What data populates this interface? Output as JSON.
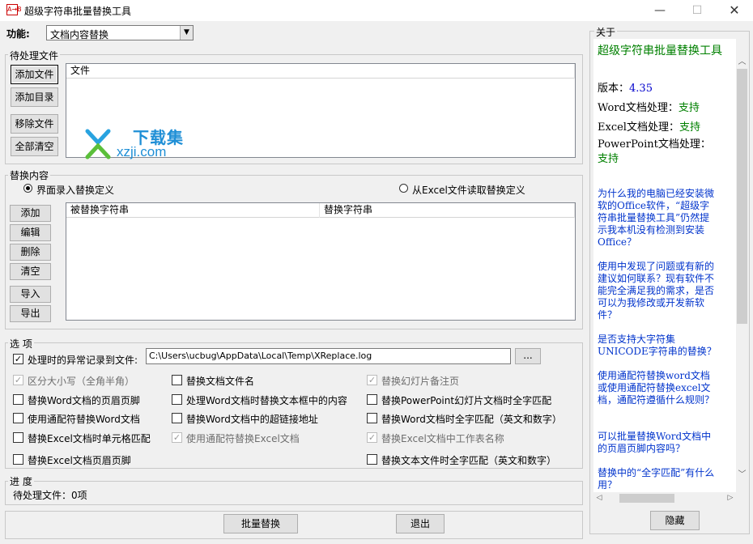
{
  "window": {
    "title": "超级字符串批量替换工具",
    "minimize": "—",
    "maximize": "☐",
    "close": "✕",
    "icon": "app-icon"
  },
  "function": {
    "label": "功能:",
    "selected": "文档内容替换"
  },
  "files": {
    "title": "待处理文件",
    "buttons": {
      "add_file": "添加文件",
      "add_dir": "添加目录",
      "remove_file": "移除文件",
      "clear_all": "全部清空"
    },
    "column": "文件"
  },
  "watermark": {
    "line1": "下载集",
    "line2": "xzji.com"
  },
  "replace": {
    "title": "替换内容",
    "radio_ui": "界面录入替换定义",
    "radio_excel": "从Excel文件读取替换定义",
    "buttons": {
      "add": "添加",
      "edit": "编辑",
      "delete": "删除",
      "clear": "清空",
      "import": "导入",
      "export": "导出"
    },
    "col_from": "被替换字符串",
    "col_to": "替换字符串"
  },
  "options": {
    "title": "选 项",
    "log_label": "处理时的异常记录到文件:",
    "log_path": "C:\\Users\\ucbug\\AppData\\Local\\Temp\\XReplace.log",
    "browse": "...",
    "items": [
      {
        "label": "区分大小写（全角半角）",
        "checked": true,
        "disabled": true
      },
      {
        "label": "替换文档文件名",
        "checked": false,
        "disabled": false
      },
      {
        "label": "替换幻灯片备注页",
        "checked": true,
        "disabled": true
      },
      {
        "label": "替换Word文档的页眉页脚",
        "checked": false,
        "disabled": false
      },
      {
        "label": "处理Word文档时替换文本框中的内容",
        "checked": false,
        "disabled": false
      },
      {
        "label": "替换PowerPoint幻灯片文档时全字匹配",
        "checked": false,
        "disabled": false
      },
      {
        "label": "使用通配符替换Word文档",
        "checked": false,
        "disabled": false
      },
      {
        "label": "替换Word文档中的超链接地址",
        "checked": false,
        "disabled": false
      },
      {
        "label": "替换Word文档时全字匹配（英文和数字）",
        "checked": false,
        "disabled": false
      },
      {
        "label": "替换Excel文档时单元格匹配",
        "checked": false,
        "disabled": false
      },
      {
        "label": "使用通配符替换Excel文档",
        "checked": true,
        "disabled": true
      },
      {
        "label": "替换Excel文档中工作表名称",
        "checked": true,
        "disabled": true
      },
      {
        "label": "替换Excel文档页眉页脚",
        "checked": false,
        "disabled": false
      },
      {
        "label": "替换文本文件时全字匹配（英文和数字）",
        "checked": false,
        "disabled": false
      }
    ]
  },
  "progress": {
    "title": "进 度",
    "status": "待处理文件：0项"
  },
  "actions": {
    "batch_replace": "批量替换",
    "exit": "退出"
  },
  "about": {
    "title": "关于",
    "app_name": "超级字符串批量替换工具",
    "version_label": "版本：",
    "version": "4.35",
    "word_label": "Word文档处理：",
    "word_value": "支持",
    "excel_label": "Excel文档处理：",
    "excel_value": "支持",
    "ppt_label": "PowerPoint文档处理：",
    "ppt_value": "支持",
    "faq": [
      "为什么我的电脑已经安装微软的Office软件，“超级字符串批量替换工具”仍然提示我本机没有检测到安装Office？",
      "使用中发现了问题或有新的建议如何联系？现有软件不能完全满足我的需求，是否可以为我修改或开发新软件？",
      "是否支持大字符集UNICODE字符串的替换？",
      "使用通配符替换word文档或使用通配符替换excel文档，通配符遵循什么规则？",
      "可以批量替换Word文档中的页眉页脚内容吗？",
      "替换中的“全字匹配”有什么用？"
    ],
    "hide": "隐藏"
  },
  "colors": {
    "accent_green": "#008000",
    "link_blue": "#0033cc",
    "version_blue": "#0000cc"
  }
}
